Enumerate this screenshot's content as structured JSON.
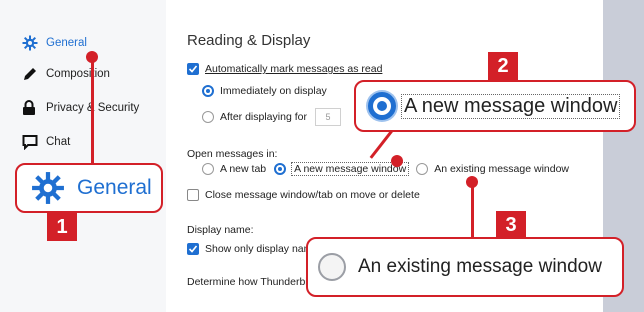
{
  "sidebar": {
    "items": [
      {
        "label": "General",
        "icon": "gear-icon"
      },
      {
        "label": "Composition",
        "icon": "pen-icon"
      },
      {
        "label": "Privacy & Security",
        "icon": "lock-icon"
      },
      {
        "label": "Chat",
        "icon": "chat-icon"
      }
    ]
  },
  "main": {
    "section_title": "Reading & Display",
    "auto_mark_label": "Automatically mark messages as read",
    "immediately_label": "Immediately on display",
    "after_label": "After displaying for",
    "after_value": "5",
    "open_messages_label": "Open messages in:",
    "open_options": [
      "A new tab",
      "A new message window",
      "An existing message window"
    ],
    "close_window_label": "Close message window/tab on move or delete",
    "display_name_label": "Display name:",
    "show_display_name_label": "Show only display nam",
    "determine_label": "Determine how Thunderbi"
  },
  "callouts": {
    "one": {
      "number": "1",
      "label": "General"
    },
    "two": {
      "number": "2",
      "label": "A new message window"
    },
    "three": {
      "number": "3",
      "label": "An existing message window"
    }
  },
  "colors": {
    "accent": "#1f6fd1",
    "callout": "#d32028"
  }
}
